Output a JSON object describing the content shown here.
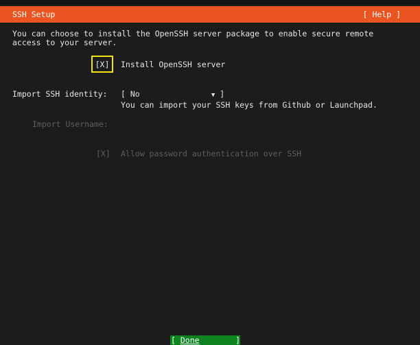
{
  "header": {
    "title": "SSH Setup",
    "help_label": "[ Help ]"
  },
  "intro_text": "You can choose to install the OpenSSH server package to enable secure remote\naccess to your server.",
  "install_openssh": {
    "checkbox": "[X]",
    "label": "Install OpenSSH server"
  },
  "import_identity": {
    "label": "Import SSH identity:",
    "select_open": "[ ",
    "value": "No",
    "arrow": "▼",
    "select_close": " ]",
    "hint": "You can import your SSH keys from Github or Launchpad."
  },
  "import_username": {
    "label": "Import Username:"
  },
  "password_auth": {
    "checkbox": "[X]",
    "label": "Allow password authentication over SSH"
  },
  "footer": {
    "done_open": "[ ",
    "done_label": "Done",
    "done_close": " ]"
  },
  "colors": {
    "accent": "#e95420",
    "focus": "#f5e414",
    "button": "#0e8420",
    "disabled": "#5e5e5e"
  }
}
